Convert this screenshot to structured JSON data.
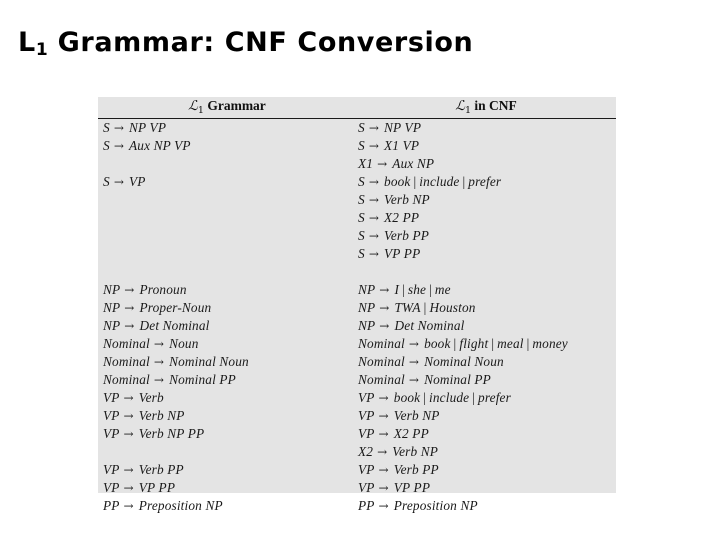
{
  "slide": {
    "title_main": "Grammar: CNF Conversion",
    "title_lead": "L",
    "title_sub": "1"
  },
  "figure": {
    "header_left_script": "ℒ",
    "header_left_index": "1",
    "header_left_text": "Grammar",
    "header_right_script": "ℒ",
    "header_right_index": "1",
    "header_right_text": "in CNF",
    "arrow": "→",
    "bar": "|",
    "left_rules": [
      {
        "lhs": "S",
        "rhs": "NP VP"
      },
      {
        "lhs": "S",
        "rhs": "Aux NP VP"
      },
      {
        "blank": true
      },
      {
        "lhs": "S",
        "rhs": "VP"
      },
      {
        "blank": true
      },
      {
        "blank": true
      },
      {
        "blank": true
      },
      {
        "blank": true
      },
      {
        "blank": true
      },
      {
        "lhs": "NP",
        "rhs": "Pronoun"
      },
      {
        "lhs": "NP",
        "rhs": "Proper-Noun"
      },
      {
        "lhs": "NP",
        "rhs": "Det Nominal"
      },
      {
        "lhs": "Nominal",
        "rhs": "Noun"
      },
      {
        "lhs": "Nominal",
        "rhs": "Nominal Noun"
      },
      {
        "lhs": "Nominal",
        "rhs": "Nominal PP"
      },
      {
        "lhs": "VP",
        "rhs": "Verb"
      },
      {
        "lhs": "VP",
        "rhs": "Verb NP"
      },
      {
        "lhs": "VP",
        "rhs": "Verb NP PP"
      },
      {
        "blank": true
      },
      {
        "lhs": "VP",
        "rhs": "Verb PP"
      },
      {
        "lhs": "VP",
        "rhs": "VP PP"
      },
      {
        "lhs": "PP",
        "rhs": "Preposition NP"
      }
    ],
    "right_rules": [
      {
        "lhs": "S",
        "rhs": "NP VP"
      },
      {
        "lhs": "S",
        "rhs": "X1 VP"
      },
      {
        "lhs": "X1",
        "rhs": "Aux NP"
      },
      {
        "lhs": "S",
        "rhs": "book | include | prefer"
      },
      {
        "lhs": "S",
        "rhs": "Verb NP"
      },
      {
        "lhs": "S",
        "rhs": "X2 PP"
      },
      {
        "lhs": "S",
        "rhs": "Verb PP"
      },
      {
        "lhs": "S",
        "rhs": "VP PP"
      },
      {
        "blank": true
      },
      {
        "lhs": "NP",
        "rhs": "I | she | me"
      },
      {
        "lhs": "NP",
        "rhs": "TWA | Houston"
      },
      {
        "lhs": "NP",
        "rhs": "Det Nominal"
      },
      {
        "lhs": "Nominal",
        "rhs": "book | flight | meal | money"
      },
      {
        "lhs": "Nominal",
        "rhs": "Nominal Noun"
      },
      {
        "lhs": "Nominal",
        "rhs": "Nominal PP"
      },
      {
        "lhs": "VP",
        "rhs": "book | include | prefer"
      },
      {
        "lhs": "VP",
        "rhs": "Verb NP"
      },
      {
        "lhs": "VP",
        "rhs": "X2 PP"
      },
      {
        "lhs": "X2",
        "rhs": "Verb NP"
      },
      {
        "lhs": "VP",
        "rhs": "Verb PP"
      },
      {
        "lhs": "VP",
        "rhs": "VP PP"
      },
      {
        "lhs": "PP",
        "rhs": "Preposition NP"
      }
    ]
  },
  "colors": {
    "page_background": "#ffffff",
    "figure_background": "#e4e4e4",
    "rule_line": "#1a1a1a",
    "text": "#1a1a1a",
    "title": "#000000"
  }
}
